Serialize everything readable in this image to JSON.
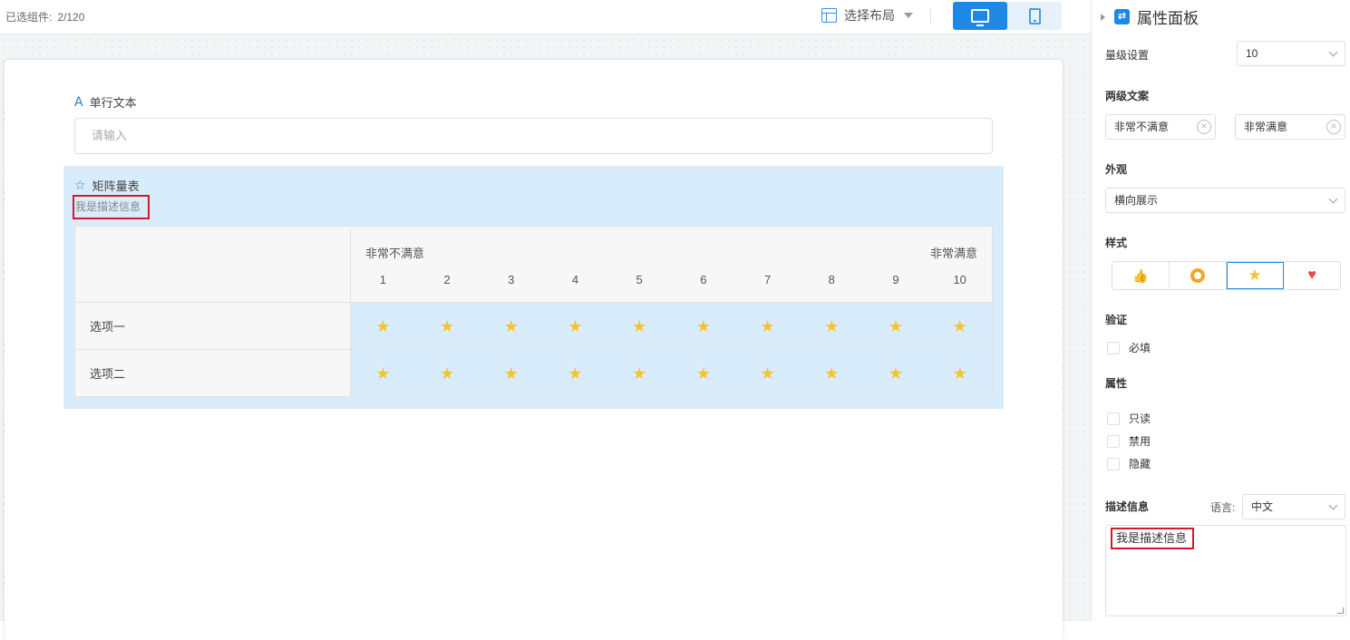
{
  "toolbar": {
    "selected_label": "已选组件:",
    "selected_count": "2/120",
    "layout_label": "选择布局"
  },
  "form": {
    "text_field": {
      "label": "单行文本",
      "placeholder": "请输入"
    },
    "matrix": {
      "label": "矩阵量表",
      "description": "我是描述信息",
      "low_label": "非常不满意",
      "high_label": "非常满意",
      "scale": [
        "1",
        "2",
        "3",
        "4",
        "5",
        "6",
        "7",
        "8",
        "9",
        "10"
      ],
      "rows": [
        {
          "label": "选项一",
          "icon": "star-icon"
        },
        {
          "label": "选项二",
          "icon": "star-icon"
        }
      ]
    }
  },
  "panel": {
    "title": "属性面板",
    "level_label": "量级设置",
    "level_value": "10",
    "two_level_label": "两级文案",
    "low_text": "非常不满意",
    "high_text": "非常满意",
    "appearance_label": "外观",
    "appearance_value": "横向展示",
    "style_label": "样式",
    "style_options": [
      "thumb-icon",
      "ring-icon",
      "star-icon",
      "heart-icon"
    ],
    "style_selected": "star-icon",
    "validation_label": "验证",
    "required_label": "必填",
    "attributes_label": "属性",
    "readonly_label": "只读",
    "disabled_label": "禁用",
    "hidden_label": "隐藏",
    "description_label": "描述信息",
    "language_label": "语言:",
    "language_value": "中文",
    "description_value": "我是描述信息"
  },
  "colors": {
    "accent": "#1e88e5",
    "star": "#f6c231",
    "highlight_border": "#d6182b",
    "matrix_bg": "#d9ecfb"
  }
}
